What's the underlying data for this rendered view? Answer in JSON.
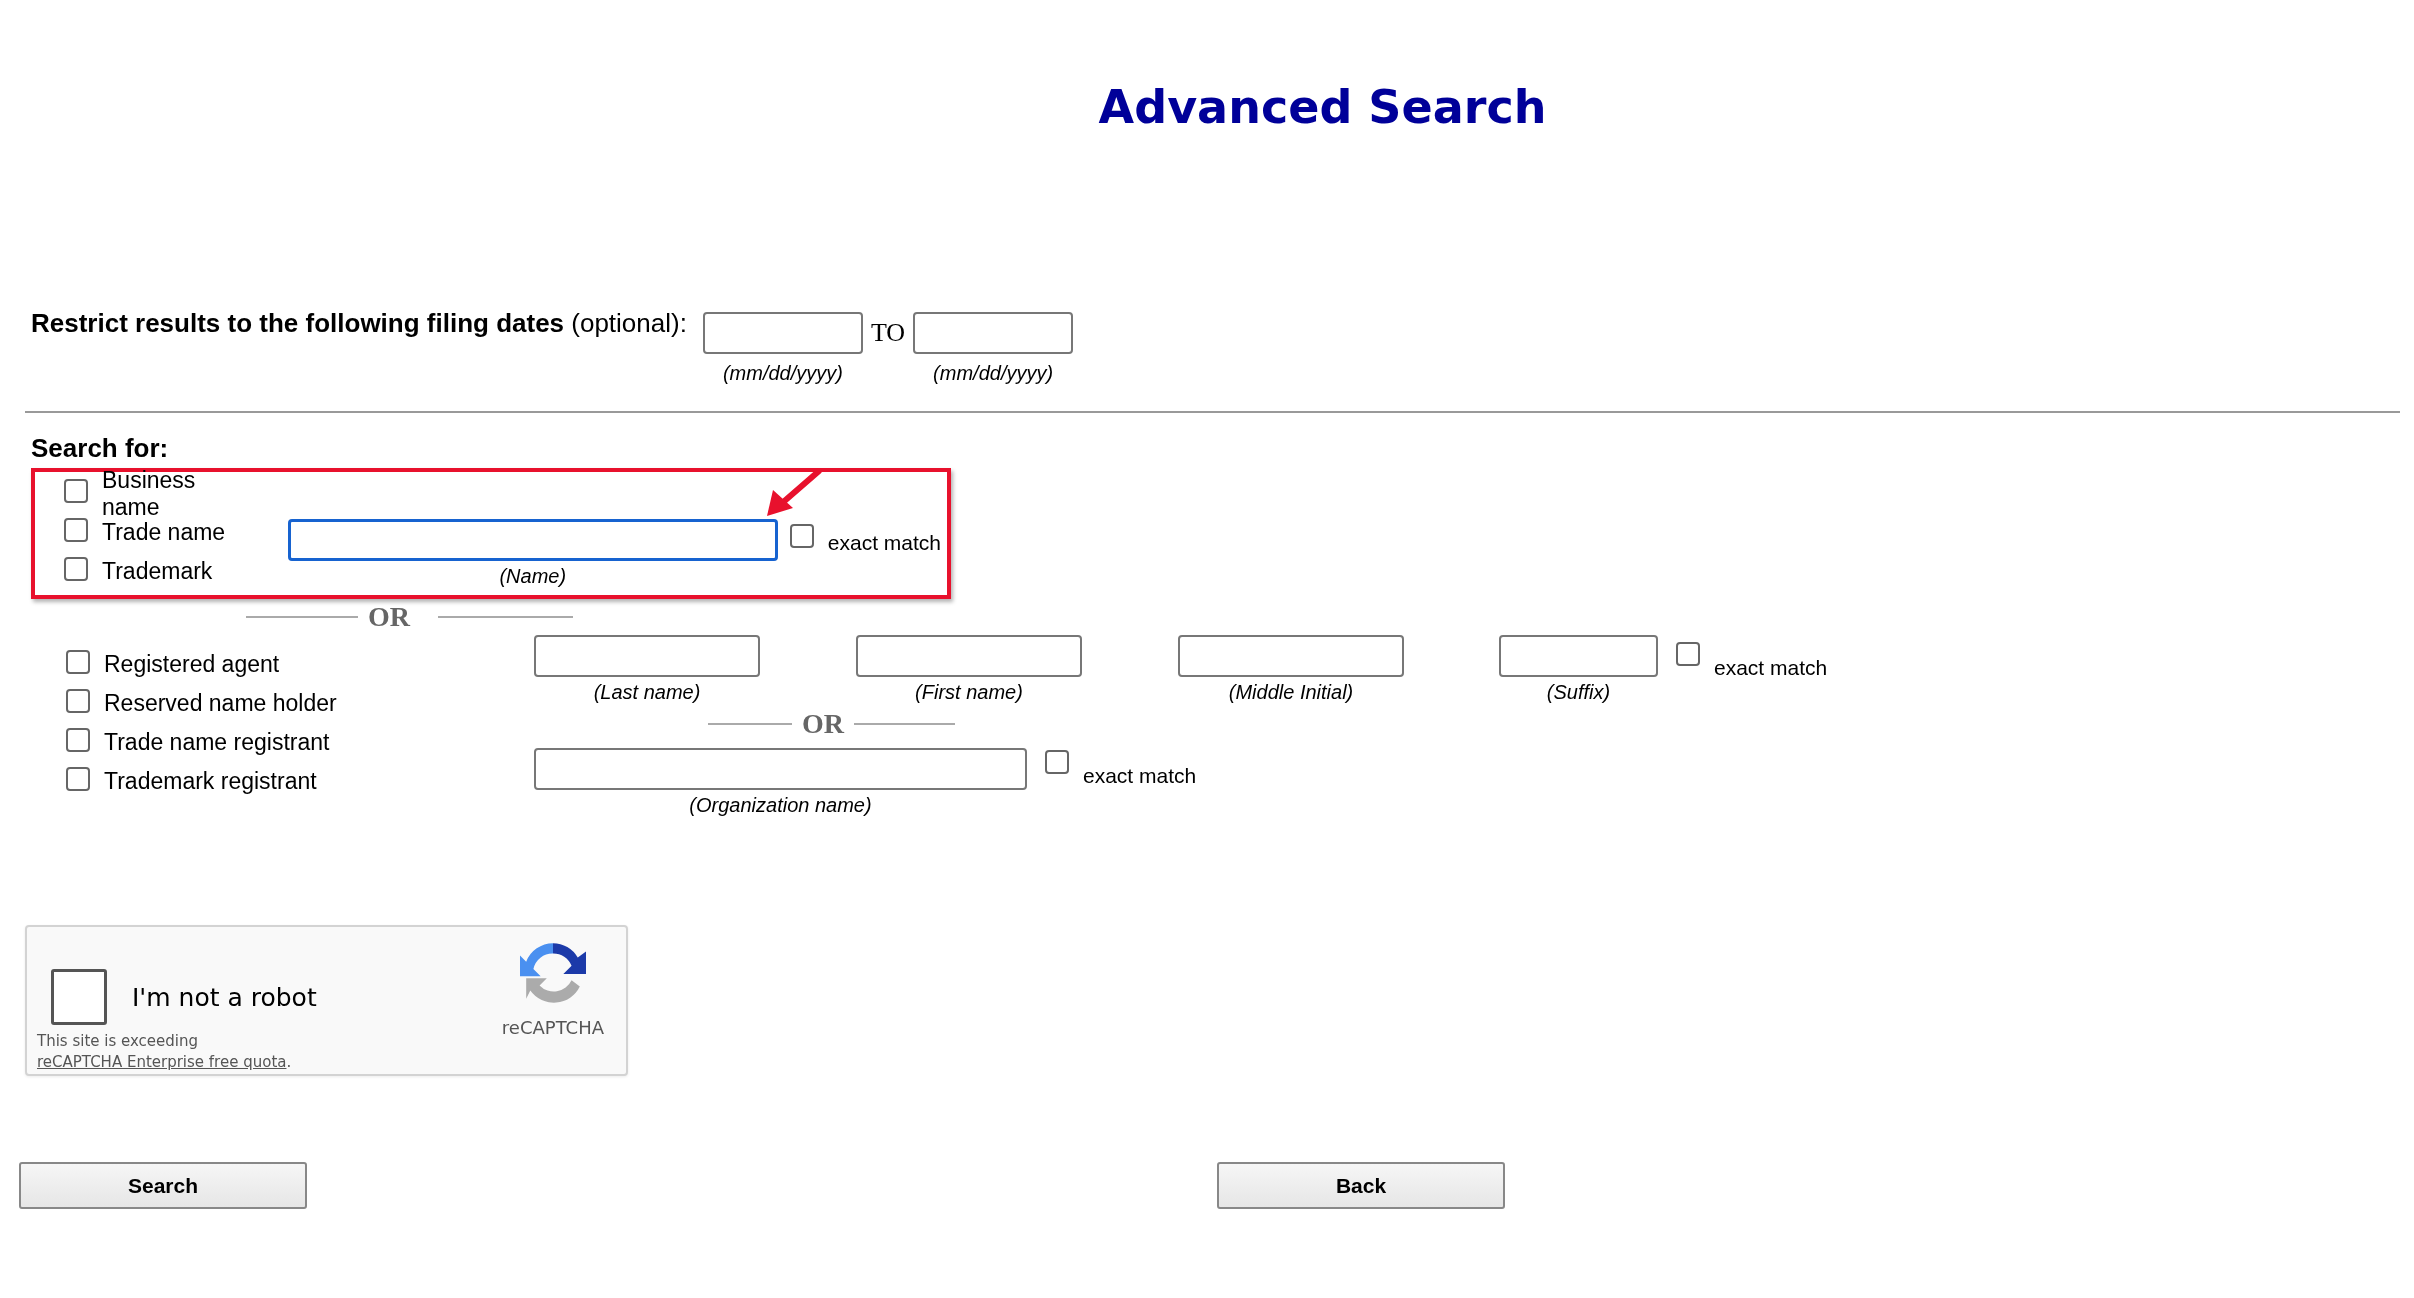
{
  "title": "Advanced Search",
  "date_filter": {
    "label": "**Restrict results to the following filing dates** (optional):",
    "from": {
      "hint": "(mm/dd/yyyy)"
    },
    "separator": "TO",
    "to": {
      "hint": "(mm/dd/yyyy)"
    }
  },
  "search_for": {
    "heading": "Search for:",
    "name_types": [
      {
        "label": "Business name",
        "checked": false
      },
      {
        "label": "Trade name",
        "checked": false
      },
      {
        "label": "Trademark",
        "checked": false
      }
    ],
    "name_field": {
      "hint": "(Name)",
      "focused": true
    },
    "exact_match": {
      "label": "exact match",
      "checked": false
    }
  },
  "or_1": "OR",
  "party_types": [
    {
      "label": "Registered agent",
      "checked": false
    },
    {
      "label": "Reserved name holder",
      "checked": false
    },
    {
      "label": "Trade name registrant",
      "checked": false
    },
    {
      "label": "Trademark registrant",
      "checked": false
    }
  ],
  "person_fields": [
    {
      "hint": "(Last name)"
    },
    {
      "hint": "(First name)"
    },
    {
      "hint": "(Middle Initial)"
    },
    {
      "hint": "(Suffix)"
    }
  ],
  "person_exact_match": {
    "label": "exact match",
    "checked": false
  },
  "or_2": "OR",
  "organization_field": {
    "hint": "(Organization name)"
  },
  "organization_exact_match": {
    "label": "exact match",
    "checked": false
  },
  "captcha": {
    "checkbox_label": "I'm not a robot",
    "checked": false,
    "notice": "This site is exceeding",
    "link": "reCAPTCHA Enterprise free quota",
    "notice_end": ".",
    "brand": "reCAPTCHA"
  },
  "buttons": [
    {
      "label": "Search"
    },
    {
      "label": "Back"
    }
  ]
}
